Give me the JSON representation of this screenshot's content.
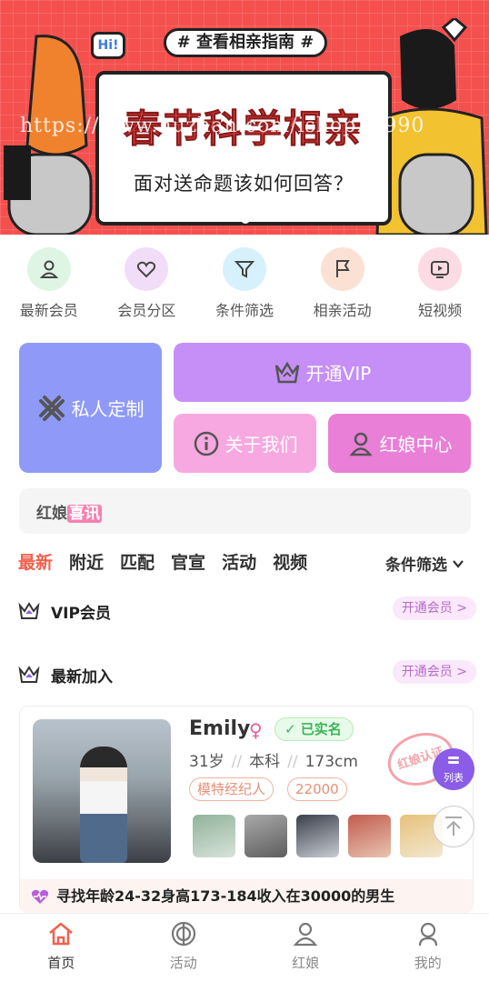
{
  "banner": {
    "tag": "# 查看相亲指南 #",
    "title": "春节科学相亲",
    "subtitle": "面对送命题该如何回答？",
    "hi": "Hi!",
    "watermark": "https://www.huzhan.com/ishop26990"
  },
  "quick_menu": [
    {
      "label": "最新会员",
      "icon": "user-icon",
      "color": "#5fd07a",
      "bg": "#dff5e4"
    },
    {
      "label": "会员分区",
      "icon": "heart-chat-icon",
      "color": "#b85fd9",
      "bg": "#f1ddf8"
    },
    {
      "label": "条件筛选",
      "icon": "filter-icon",
      "color": "#3aaed8",
      "bg": "#d6f1fb"
    },
    {
      "label": "相亲活动",
      "icon": "flag-icon",
      "color": "#e77b50",
      "bg": "#fbe1d4"
    },
    {
      "label": "短视频",
      "icon": "video-icon",
      "color": "#ef5e84",
      "bg": "#fcdbe4"
    }
  ],
  "tiles": {
    "custom": "私人定制",
    "vip": "开通VIP",
    "about": "关于我们",
    "matchmaker": "红娘中心"
  },
  "news": {
    "prefix": "红娘",
    "badge": "喜讯"
  },
  "tabs": [
    "最新",
    "附近",
    "匹配",
    "官宣",
    "活动",
    "视频"
  ],
  "active_tab": "最新",
  "filter_label": "条件筛选",
  "sections": {
    "vip": {
      "title": "VIP会员",
      "action": "开通会员 >"
    },
    "latest": {
      "title": "最新加入",
      "action": "开通会员 >"
    }
  },
  "member": {
    "name": "Emily",
    "gender_symbol": "♀",
    "verified": "已实名",
    "age": "31岁",
    "education": "本科",
    "height": "173cm",
    "tags": [
      "模特经纪人",
      "22000"
    ],
    "stamp": "红娘认证",
    "wish": "寻找年龄24-32身高173-184收入在30000的男生"
  },
  "float": {
    "list_label": "列表"
  },
  "bottom_nav": [
    {
      "label": "首页",
      "icon": "home-icon",
      "active": true
    },
    {
      "label": "活动",
      "icon": "activity-icon",
      "active": false
    },
    {
      "label": "红娘",
      "icon": "matchmaker-icon",
      "active": false
    },
    {
      "label": "我的",
      "icon": "profile-icon",
      "active": false
    }
  ],
  "colors": {
    "accent": "#f0604c",
    "vip_purple": "#c68ff7",
    "custom_blue": "#8f9af8",
    "pink": "#f8a8e0",
    "magenta": "#e97fd7"
  }
}
